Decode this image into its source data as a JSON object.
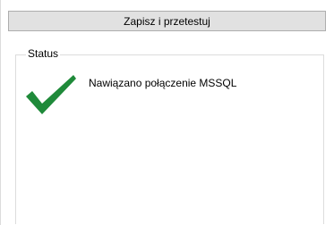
{
  "toolbar": {
    "save_test_label": "Zapisz i przetestuj"
  },
  "status_group": {
    "legend": "Status",
    "icon": "checkmark-icon",
    "message": "Nawiązano połączenie MSSQL",
    "icon_color": "#1f8a3a"
  }
}
